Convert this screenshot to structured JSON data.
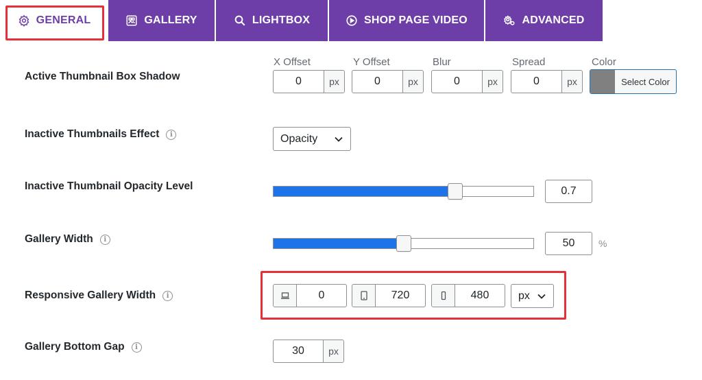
{
  "tabs": [
    {
      "label": "GENERAL",
      "icon": "gear-icon"
    },
    {
      "label": "GALLERY",
      "icon": "gallery-icon"
    },
    {
      "label": "LIGHTBOX",
      "icon": "search-icon"
    },
    {
      "label": "SHOP PAGE VIDEO",
      "icon": "play-icon"
    },
    {
      "label": "ADVANCED",
      "icon": "settings-gear-icon"
    }
  ],
  "active_tab": "GENERAL",
  "colors": {
    "tab_bg": "#6e3ea8",
    "highlight": "#e5303a",
    "slider_fill": "#1e73e8",
    "swatch": "#808080"
  },
  "shadow": {
    "label": "Active Thumbnail Box Shadow",
    "x_label": "X Offset",
    "x_value": "0",
    "y_label": "Y Offset",
    "y_value": "0",
    "blur_label": "Blur",
    "blur_value": "0",
    "spread_label": "Spread",
    "spread_value": "0",
    "unit": "px",
    "color_label": "Color",
    "color_button": "Select Color"
  },
  "inactive_effect": {
    "label": "Inactive Thumbnails Effect",
    "selected": "Opacity"
  },
  "opacity_level": {
    "label": "Inactive Thumbnail Opacity Level",
    "value": "0.7",
    "fraction": 0.7
  },
  "gallery_width": {
    "label": "Gallery Width",
    "value": "50",
    "unit": "%",
    "fraction": 0.5
  },
  "responsive_width": {
    "label": "Responsive Gallery Width",
    "desktop_value": "0",
    "tablet_value": "720",
    "mobile_value": "480",
    "unit": "px"
  },
  "bottom_gap": {
    "label": "Gallery Bottom Gap",
    "value": "30",
    "unit": "px"
  }
}
